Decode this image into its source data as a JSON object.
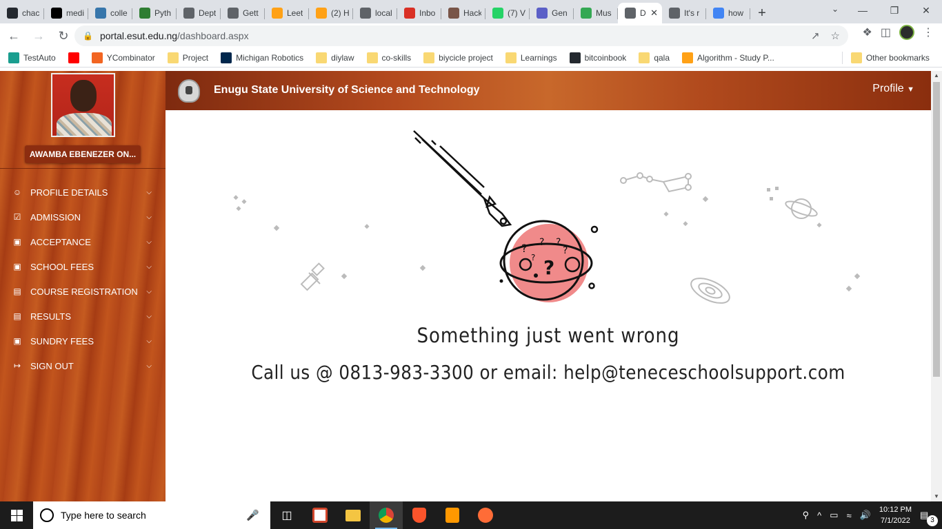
{
  "browser": {
    "tabs": [
      {
        "label": "chac",
        "icon": "github-icon",
        "color": "#24292f"
      },
      {
        "label": "medi",
        "icon": "medium-icon",
        "color": "#000000"
      },
      {
        "label": "colle",
        "icon": "python-icon",
        "color": "#3776ab"
      },
      {
        "label": "Pyth",
        "icon": "infinity-icon",
        "color": "#2e7d32"
      },
      {
        "label": "Dept",
        "icon": "doc-icon",
        "color": "#5f6368"
      },
      {
        "label": "Gett",
        "icon": "doc-icon",
        "color": "#5f6368"
      },
      {
        "label": "Leet",
        "icon": "leetcode-icon",
        "color": "#ffa116"
      },
      {
        "label": "(2) H",
        "icon": "leetcode-icon",
        "color": "#ffa116"
      },
      {
        "label": "local",
        "icon": "globe-icon",
        "color": "#5f6368"
      },
      {
        "label": "Inbo",
        "icon": "gmail-icon",
        "color": "#d93025"
      },
      {
        "label": "Hack",
        "icon": "tools-icon",
        "color": "#795548"
      },
      {
        "label": "(7) V",
        "icon": "whatsapp-icon",
        "color": "#25d366"
      },
      {
        "label": "Gen",
        "icon": "gen-icon",
        "color": "#5b5fc7"
      },
      {
        "label": "Mus",
        "icon": "maps-icon",
        "color": "#34a853"
      },
      {
        "label": "D",
        "icon": "globe-icon",
        "color": "#5f6368",
        "active": true
      },
      {
        "label": "It's r",
        "icon": "globe-icon",
        "color": "#5f6368"
      },
      {
        "label": "how",
        "icon": "google-icon",
        "color": "#4285f4"
      }
    ],
    "new_tab": "+",
    "url_host": "portal.esut.edu.ng",
    "url_path": "/dashboard.aspx",
    "bookmarks": [
      {
        "label": "TestAuto",
        "icon": "testauto-icon",
        "color": "#1a9e8f"
      },
      {
        "label": "",
        "icon": "youtube-icon",
        "color": "#ff0000"
      },
      {
        "label": "YCombinator",
        "icon": "ycombinator-icon",
        "color": "#f26522"
      },
      {
        "label": "Project",
        "icon": "folder-icon",
        "color": "#f9d873"
      },
      {
        "label": "Michigan Robotics",
        "icon": "michigan-icon",
        "color": "#00274c"
      },
      {
        "label": "diylaw",
        "icon": "folder-icon",
        "color": "#f9d873"
      },
      {
        "label": "co-skills",
        "icon": "folder-icon",
        "color": "#f9d873"
      },
      {
        "label": "biycicle project",
        "icon": "folder-icon",
        "color": "#f9d873"
      },
      {
        "label": "Learnings",
        "icon": "folder-icon",
        "color": "#f9d873"
      },
      {
        "label": "bitcoinbook",
        "icon": "github-icon",
        "color": "#24292f"
      },
      {
        "label": "qala",
        "icon": "folder-icon",
        "color": "#f9d873"
      },
      {
        "label": "Algorithm - Study P...",
        "icon": "leetcode-icon",
        "color": "#ffa116"
      }
    ],
    "other_bookmarks": "Other bookmarks"
  },
  "portal": {
    "user_name": "AWAMBA EBENEZER ON...",
    "university": "Enugu State University of Science and Technology",
    "profile_menu": "Profile",
    "menu": [
      {
        "label": "PROFILE DETAILS",
        "icon": "user-icon"
      },
      {
        "label": "ADMISSION",
        "icon": "checkbox-icon"
      },
      {
        "label": "ACCEPTANCE",
        "icon": "money-icon"
      },
      {
        "label": "SCHOOL FEES",
        "icon": "money-icon"
      },
      {
        "label": "COURSE REGISTRATION",
        "icon": "document-icon"
      },
      {
        "label": "RESULTS",
        "icon": "document-icon"
      },
      {
        "label": "SUNDRY FEES",
        "icon": "money-icon"
      },
      {
        "label": "SIGN OUT",
        "icon": "signout-icon"
      }
    ],
    "error_title": "Something just went wrong",
    "error_contact": "Call us @ 0813-983-3300 or email: help@teneceschoolsupport.com"
  },
  "taskbar": {
    "search_placeholder": "Type here to search",
    "time": "10:12 PM",
    "date": "7/1/2022",
    "notifications": "3"
  },
  "colors": {
    "sidebar": "#b4471a",
    "header": "#a23f17",
    "planet": "#f08a8a"
  }
}
